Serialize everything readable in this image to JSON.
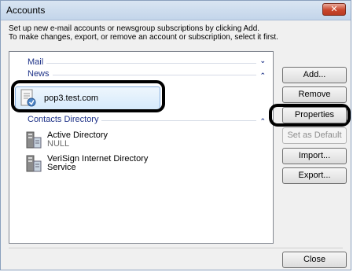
{
  "window": {
    "title": "Accounts",
    "close_glyph": "✕"
  },
  "intro": {
    "line1": "Set up new e-mail accounts or newsgroup subscriptions by clicking Add.",
    "line2": "To make changes, export, or remove an account or subscription, select it first."
  },
  "groups": {
    "mail": {
      "label": "Mail",
      "chevron": "⌄"
    },
    "news": {
      "label": "News",
      "chevron": "⌃",
      "items": [
        {
          "name": "pop3.test.com",
          "icon": "news-account-icon"
        }
      ]
    },
    "contacts": {
      "label": "Contacts Directory",
      "chevron": "⌃",
      "items": [
        {
          "name": "Active Directory",
          "sub": "NULL",
          "icon": "directory-server-icon"
        },
        {
          "name": "VeriSign Internet Directory",
          "sub": "Service",
          "icon": "directory-server-icon"
        }
      ]
    }
  },
  "buttons": {
    "add": "Add...",
    "remove": "Remove",
    "properties": "Properties",
    "set_default": "Set as Default",
    "import": "Import...",
    "export": "Export...",
    "close": "Close"
  },
  "colors": {
    "group_header": "#1e3287",
    "selection_fill": "#d6eafb",
    "close_button": "#c9462c"
  }
}
